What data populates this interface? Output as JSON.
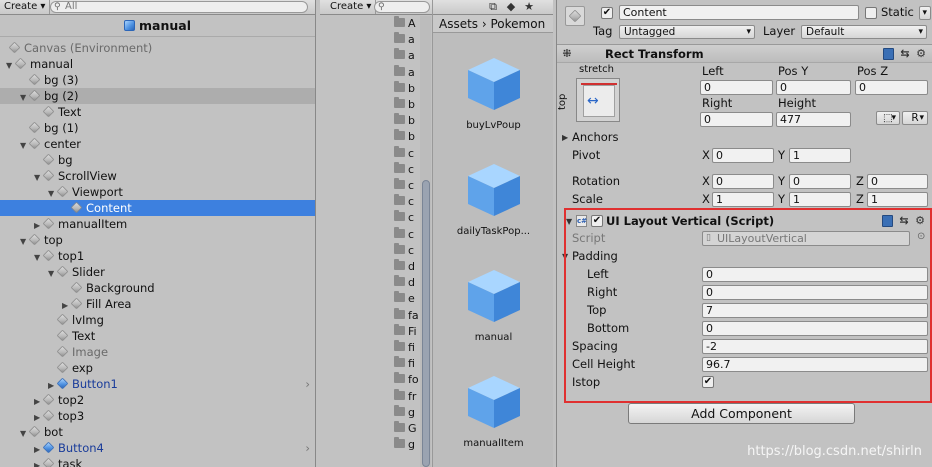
{
  "hierarchy": {
    "create_label": "Create",
    "search_placeholder": "All",
    "scene_name": "manual",
    "rows": [
      {
        "label": "Canvas (Environment)",
        "dim": true
      },
      {
        "label": "manual"
      },
      {
        "label": "bg (3)"
      },
      {
        "label": "bg (2)"
      },
      {
        "label": "Text"
      },
      {
        "label": "bg (1)"
      },
      {
        "label": "center"
      },
      {
        "label": "bg"
      },
      {
        "label": "ScrollView"
      },
      {
        "label": "Viewport"
      },
      {
        "label": "Content"
      },
      {
        "label": "manualItem"
      },
      {
        "label": "top"
      },
      {
        "label": "top1"
      },
      {
        "label": "Slider"
      },
      {
        "label": "Background"
      },
      {
        "label": "Fill Area"
      },
      {
        "label": "lvImg"
      },
      {
        "label": "Text"
      },
      {
        "label": "Image",
        "dim": true
      },
      {
        "label": "exp"
      },
      {
        "label": "Button1"
      },
      {
        "label": "top2"
      },
      {
        "label": "top3"
      },
      {
        "label": "bot"
      },
      {
        "label": "Button4"
      },
      {
        "label": "task"
      }
    ]
  },
  "project": {
    "create_label": "Create",
    "tree_items": [
      "A",
      "a",
      "a",
      "a",
      "b",
      "b",
      "b",
      "b",
      "c",
      "c",
      "c",
      "c",
      "c",
      "c",
      "c",
      "d",
      "d",
      "e",
      "fa",
      "Fi",
      "fi",
      "fi",
      "fo",
      "fr",
      "g",
      "G",
      "g"
    ],
    "breadcrumb": "Assets › Pokemon",
    "assets": [
      "buyLvPoup",
      "dailyTaskPop...",
      "manual",
      "manualItem"
    ]
  },
  "inspector": {
    "object_name": "Content",
    "static_label": "Static",
    "tag_label": "Tag",
    "tag_value": "Untagged",
    "layer_label": "Layer",
    "layer_value": "Default",
    "rect_transform": {
      "title": "Rect Transform",
      "stretch": "stretch",
      "side": "top",
      "col_left": "Left",
      "col_posy": "Pos Y",
      "col_posz": "Pos Z",
      "left": "0",
      "posy": "0",
      "posz": "0",
      "col_right": "Right",
      "col_height": "Height",
      "right": "0",
      "height": "477",
      "r_button": "R",
      "anchors": "Anchors",
      "pivot_label": "Pivot",
      "pivot_x": "0",
      "pivot_y": "1",
      "rotation_label": "Rotation",
      "rot_x": "0",
      "rot_y": "0",
      "rot_z": "0",
      "scale_label": "Scale",
      "scale_x": "1",
      "scale_y": "1",
      "scale_z": "1",
      "x": "X",
      "y": "Y",
      "z": "Z"
    },
    "layout": {
      "title": "UI Layout Vertical (Script)",
      "script_label": "Script",
      "script_value": "UILayoutVertical",
      "padding_label": "Padding",
      "left_label": "Left",
      "left": "0",
      "right_label": "Right",
      "right": "0",
      "top_label": "Top",
      "top": "7",
      "bottom_label": "Bottom",
      "bottom": "0",
      "spacing_label": "Spacing",
      "spacing": "-2",
      "cell_height_label": "Cell Height",
      "cell_height": "96.7",
      "istop_label": "Istop",
      "istop": true
    },
    "add_component": "Add Component"
  },
  "watermark": "https://blog.csdn.net/shirln",
  "colors": {
    "selection": "#3d80df",
    "highlight_box": "#e03030",
    "prefab_text": "#1a3c9a"
  }
}
